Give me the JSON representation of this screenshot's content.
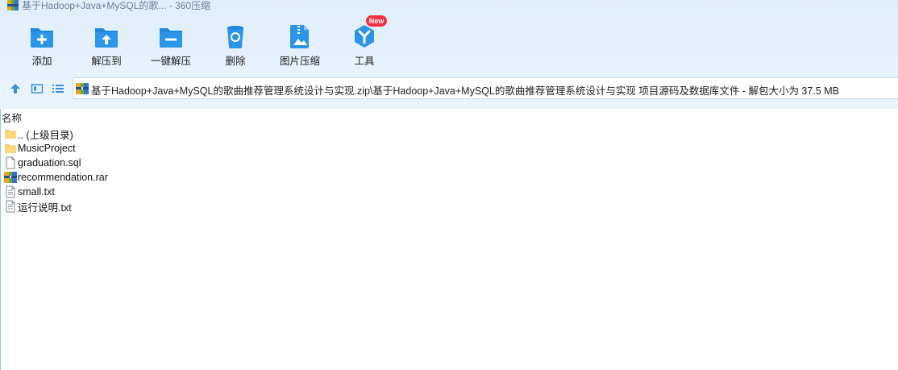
{
  "window": {
    "title": "基于Hadoop+Java+MySQL的歌... - 360压缩"
  },
  "toolbar": {
    "items": [
      {
        "label": "添加",
        "icon": "add-icon"
      },
      {
        "label": "解压到",
        "icon": "extract-to-icon"
      },
      {
        "label": "一键解压",
        "icon": "one-click-extract-icon"
      },
      {
        "label": "删除",
        "icon": "delete-icon"
      },
      {
        "label": "图片压缩",
        "icon": "image-compress-icon"
      },
      {
        "label": "工具",
        "icon": "tools-icon"
      }
    ],
    "badge": "New"
  },
  "navbar": {
    "path": "基于Hadoop+Java+MySQL的歌曲推荐管理系统设计与实现.zip\\基于Hadoop+Java+MySQL的歌曲推荐管理系统设计与实现 项目源码及数据库文件 - 解包大小为 37.5 MB"
  },
  "list": {
    "column_name": "名称",
    "files": [
      {
        "name": ".. (上级目录)",
        "type": "folder"
      },
      {
        "name": "MusicProject",
        "type": "folder"
      },
      {
        "name": "graduation.sql",
        "type": "file"
      },
      {
        "name": "recommendation.rar",
        "type": "archive"
      },
      {
        "name": "small.txt",
        "type": "text"
      },
      {
        "name": "运行说明.txt",
        "type": "text"
      }
    ]
  },
  "colors": {
    "accent": "#1e88e5",
    "toolbar_bg": "#e3f0fc",
    "badge": "#f2313f"
  }
}
